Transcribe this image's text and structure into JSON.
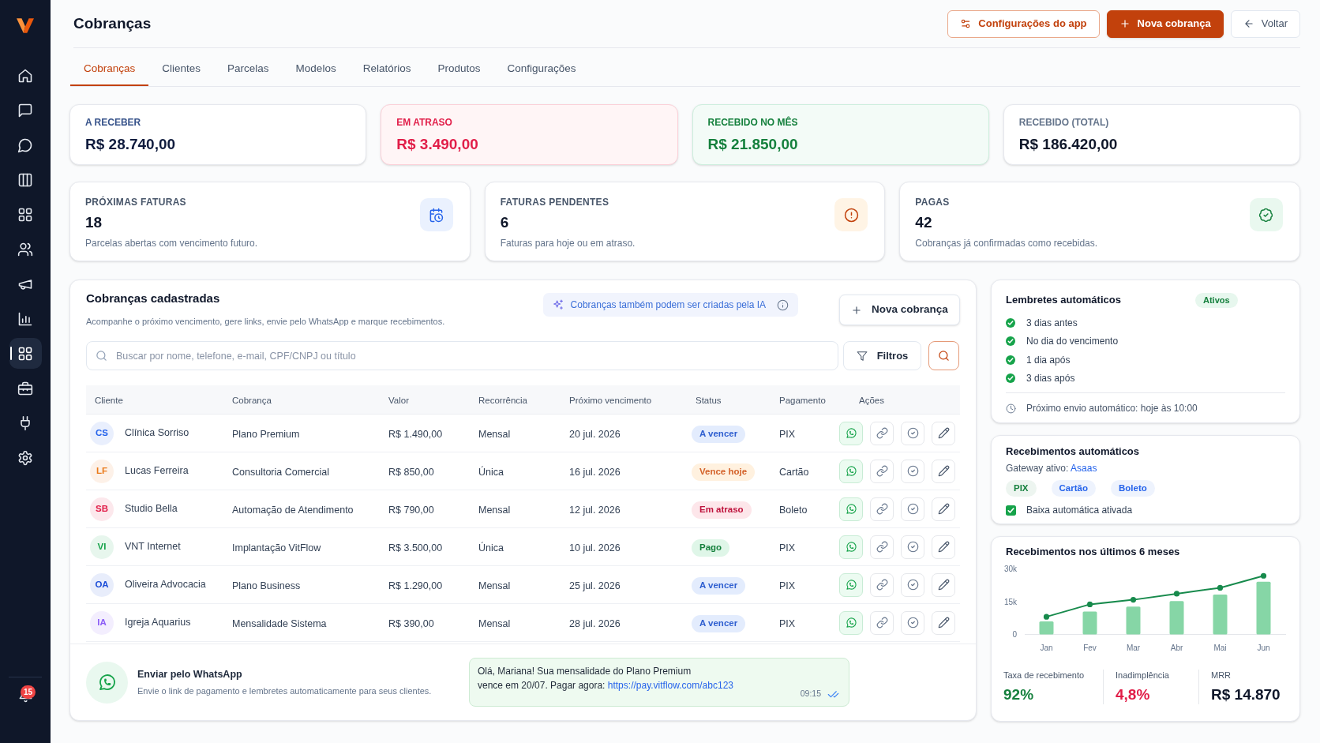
{
  "sidebar": {
    "items": [
      {
        "kind": "home",
        "selected": false
      },
      {
        "kind": "inbox",
        "selected": false
      },
      {
        "kind": "chat",
        "selected": false
      },
      {
        "kind": "columns",
        "selected": false
      },
      {
        "kind": "apps",
        "selected": false
      },
      {
        "kind": "users",
        "selected": false
      },
      {
        "kind": "campaigns",
        "selected": false
      },
      {
        "kind": "reports",
        "selected": false
      },
      {
        "kind": "modules",
        "selected": true
      },
      {
        "kind": "toolbox",
        "selected": false
      },
      {
        "kind": "integrations",
        "selected": false
      },
      {
        "kind": "settings",
        "selected": false
      }
    ],
    "notifications": {
      "count": "15"
    }
  },
  "header": {
    "title": "Cobranças",
    "actions": [
      {
        "label": "Configurações do app",
        "kind": "settings"
      },
      {
        "label": "Nova cobrança",
        "kind": "create"
      },
      {
        "label": "Voltar",
        "kind": "back"
      }
    ]
  },
  "tabs": [
    {
      "label": "Cobranças",
      "selected": true
    },
    {
      "label": "Clientes",
      "selected": false
    },
    {
      "label": "Parcelas",
      "selected": false
    },
    {
      "label": "Modelos",
      "selected": false
    },
    {
      "label": "Relatórios",
      "selected": false
    },
    {
      "label": "Produtos",
      "selected": false
    },
    {
      "label": "Configurações",
      "selected": false
    }
  ],
  "totals": [
    {
      "label": "A RECEBER",
      "value": "R$ 28.740,00",
      "kind": "info"
    },
    {
      "label": "EM ATRASO",
      "value": "R$ 3.490,00",
      "kind": "danger"
    },
    {
      "label": "RECEBIDO NO MÊS",
      "value": "R$ 21.850,00",
      "kind": "success"
    },
    {
      "label": "RECEBIDO (TOTAL)",
      "value": "R$ 186.420,00",
      "kind": "neutral"
    }
  ],
  "summary_cards": [
    {
      "label": "PRÓXIMAS FATURAS",
      "value": "18",
      "description": "Parcelas abertas com vencimento futuro.",
      "kind": "upcoming"
    },
    {
      "label": "FATURAS PENDENTES",
      "value": "6",
      "description": "Faturas para hoje ou em atraso.",
      "kind": "pending"
    },
    {
      "label": "PAGAS",
      "value": "42",
      "description": "Cobranças já confirmadas como recebidas.",
      "kind": "paid"
    }
  ],
  "charges": {
    "title": "Cobranças cadastradas",
    "subtitle": "Acompanhe o próximo vencimento, gere links, envie pelo WhatsApp e marque recebimentos.",
    "ai_hint": "Cobranças também podem ser criadas pela IA",
    "new_button": "Nova cobrança",
    "search": {
      "placeholder": "Buscar por nome, telefone, e-mail, CPF/CNPJ ou título"
    },
    "filter_button": "Filtros",
    "table": {
      "columns": [
        "Cliente",
        "Cobrança",
        "Valor",
        "Recorrência",
        "Próximo vencimento",
        "Status",
        "Pagamento",
        "Ações"
      ],
      "rows": [
        {
          "initials": "CS",
          "color": "#2563eb",
          "client": "Clínica Sorriso",
          "charge": "Plano Premium",
          "amount": "R$ 1.490,00",
          "recurrence": "Mensal",
          "due": "20 jul. 2026",
          "status": {
            "label": "A vencer",
            "kind": "upcoming"
          },
          "payment": "PIX"
        },
        {
          "initials": "LF",
          "color": "#ea7a1a",
          "client": "Lucas Ferreira",
          "charge": "Consultoria Comercial",
          "amount": "R$ 850,00",
          "recurrence": "Única",
          "due": "16 jul. 2026",
          "status": {
            "label": "Vence hoje",
            "kind": "today"
          },
          "payment": "Cartão"
        },
        {
          "initials": "SB",
          "color": "#e11d48",
          "client": "Studio Bella",
          "charge": "Automação de Atendimento",
          "amount": "R$ 790,00",
          "recurrence": "Mensal",
          "due": "12 jul. 2026",
          "status": {
            "label": "Em atraso",
            "kind": "overdue"
          },
          "payment": "Boleto"
        },
        {
          "initials": "VI",
          "color": "#16a34a",
          "client": "VNT Internet",
          "charge": "Implantação VitFlow",
          "amount": "R$ 3.500,00",
          "recurrence": "Única",
          "due": "10 jul. 2026",
          "status": {
            "label": "Pago",
            "kind": "paid"
          },
          "payment": "PIX"
        },
        {
          "initials": "OA",
          "color": "#1d4ed8",
          "client": "Oliveira Advocacia",
          "charge": "Plano Business",
          "amount": "R$ 1.290,00",
          "recurrence": "Mensal",
          "due": "25 jul. 2026",
          "status": {
            "label": "A vencer",
            "kind": "upcoming"
          },
          "payment": "PIX"
        },
        {
          "initials": "IA",
          "color": "#8b5cf6",
          "client": "Igreja Aquarius",
          "charge": "Mensalidade Sistema",
          "amount": "R$ 390,00",
          "recurrence": "Mensal",
          "due": "28 jul. 2026",
          "status": {
            "label": "A vencer",
            "kind": "upcoming"
          },
          "payment": "PIX"
        }
      ]
    }
  },
  "whatsapp": {
    "title": "Enviar pelo WhatsApp",
    "description": "Envie o link de pagamento e lembretes automaticamente para seus clientes.",
    "message": {
      "lines": [
        "Olá, Mariana! Sua mensalidade do Plano Premium",
        "vence em 20/07. Pagar agora:"
      ],
      "link": "https://pay.vitflow.com/abc123",
      "time": "09:15",
      "read": true
    }
  },
  "reminders": {
    "title": "Lembretes automáticos",
    "badge": "Ativos",
    "items": [
      {
        "label": "3 dias antes",
        "checked": true
      },
      {
        "label": "No dia do vencimento",
        "checked": true
      },
      {
        "label": "1 dia após",
        "checked": true
      },
      {
        "label": "3 dias após",
        "checked": true
      }
    ],
    "next_send": "Próximo envio automático: hoje às 10:00"
  },
  "auto_receipts": {
    "title": "Recebimentos automáticos",
    "gateway": {
      "label": "Gateway ativo:",
      "name": "Asaas"
    },
    "methods": [
      {
        "label": "PIX",
        "color": "#15803d"
      },
      {
        "label": "Cartão",
        "color": "#2563eb"
      },
      {
        "label": "Boleto",
        "color": "#2563eb"
      }
    ],
    "auto_settle": {
      "label": "Baixa automática ativada",
      "checked": true
    }
  },
  "history": {
    "title": "Recebimentos nos últimos 6 meses",
    "chart_data": {
      "type": "bar",
      "categories": [
        "Jan",
        "Fev",
        "Mar",
        "Abr",
        "Mai",
        "Jun"
      ],
      "ylim": [
        0,
        30000
      ],
      "yticks": [
        {
          "value": 0,
          "label": "0"
        },
        {
          "value": 15000,
          "label": "15k"
        },
        {
          "value": 30000,
          "label": "30k"
        }
      ],
      "series": [
        {
          "color": "#86d6a6",
          "values": [
            6000,
            10500,
            12800,
            15300,
            18300,
            24200
          ]
        },
        {
          "type": "line",
          "marker": "circle",
          "color": "#178a4c",
          "values": [
            8100,
            13800,
            15900,
            18700,
            21400,
            26900
          ]
        }
      ]
    },
    "metrics": [
      {
        "label": "Taxa de recebimento",
        "value": "92%",
        "color": "#15803d"
      },
      {
        "label": "Inadimplência",
        "value": "4,8%",
        "color": "#e11d48"
      },
      {
        "label": "MRR",
        "value": "R$ 14.870",
        "color": "#0f172a"
      }
    ]
  }
}
